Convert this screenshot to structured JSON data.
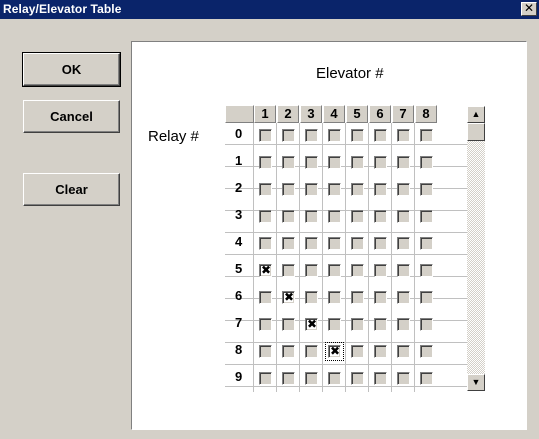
{
  "window": {
    "title": "Relay/Elevator Table",
    "close_glyph": "✕"
  },
  "buttons": {
    "ok": "OK",
    "cancel": "Cancel",
    "clear": "Clear"
  },
  "labels": {
    "elevator": "Elevator #",
    "relay": "Relay #"
  },
  "grid": {
    "columns": [
      "1",
      "2",
      "3",
      "4",
      "5",
      "6",
      "7",
      "8"
    ],
    "rows": [
      "0",
      "1",
      "2",
      "3",
      "4",
      "5",
      "6",
      "7",
      "8",
      "9"
    ],
    "checked": [
      [
        5,
        1
      ],
      [
        6,
        2
      ],
      [
        7,
        3
      ],
      [
        8,
        4
      ]
    ],
    "focused": [
      8,
      4
    ],
    "check_glyph": "✖"
  },
  "scrollbar": {
    "up_glyph": "▲",
    "down_glyph": "▼"
  }
}
